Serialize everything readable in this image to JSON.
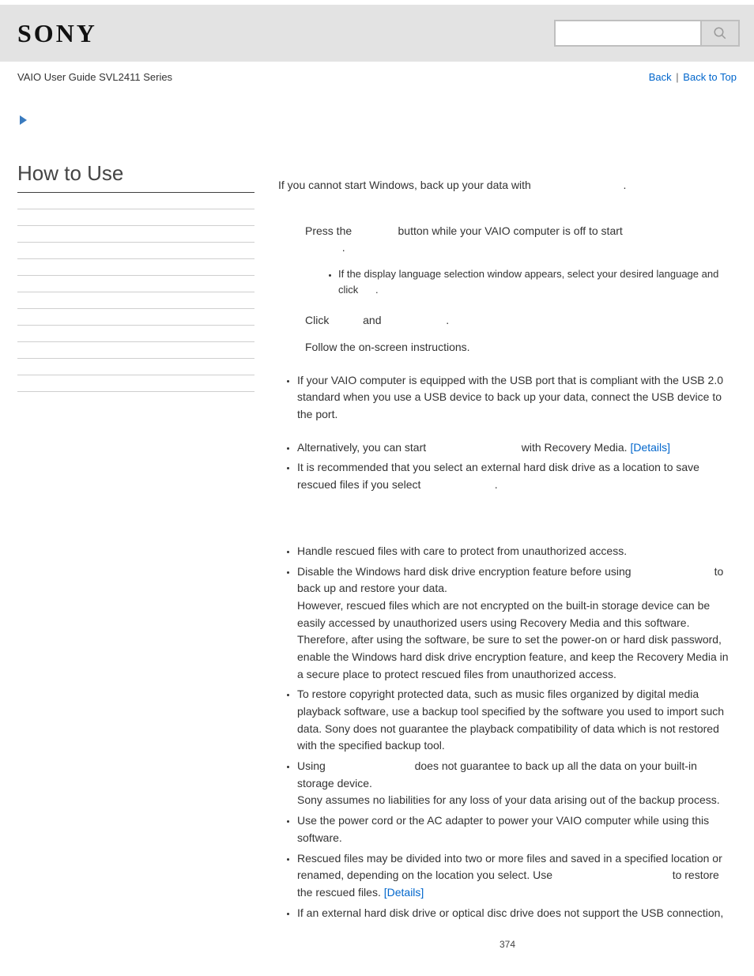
{
  "header": {
    "logo": "SONY",
    "search_placeholder": ""
  },
  "subheader": {
    "left": "VAIO User Guide SVL2411 Series",
    "back": "Back",
    "back_to_top": "Back to Top"
  },
  "sidebar": {
    "title": "How to Use"
  },
  "content": {
    "intro_1": "If you cannot start Windows, back up your data with ",
    "intro_2": ".",
    "step1_a": "Press the ",
    "step1_b": " button while your VAIO computer is off to start",
    "step1_c": ".",
    "sub1_a": "If the display language selection window appears, select your desired language and click ",
    "sub1_b": ".",
    "step2_a": "Click ",
    "step2_b": " and ",
    "step2_c": ".",
    "step3": "Follow the on-screen instructions.",
    "usb_note": "If your VAIO computer is equipped with the USB port that is compliant with the USB 2.0 standard when you use a USB device to back up your data, connect the USB device to the port.",
    "alt1_a": "Alternatively, you can start ",
    "alt1_b": " with Recovery Media. ",
    "details": "[Details]",
    "alt2_a": "It is recommended that you select an external hard disk drive as a location to save rescued files if you select ",
    "alt2_b": ".",
    "note1": "Handle rescued files with care to protect from unauthorized access.",
    "note2_a": "Disable the Windows hard disk drive encryption feature before using ",
    "note2_b": " to back up and restore your data.",
    "note2_c": "However, rescued files which are not encrypted on the built-in storage device can be easily accessed by unauthorized users using Recovery Media and this software. Therefore, after using the software, be sure to set the power-on or hard disk password, enable the Windows hard disk drive encryption feature, and keep the Recovery Media in a secure place to protect rescued files from unauthorized access.",
    "note3": "To restore copyright protected data, such as music files organized by digital media playback software, use a backup tool specified by the software you used to import such data. Sony does not guarantee the playback compatibility of data which is not restored with the specified backup tool.",
    "note4_a": "Using ",
    "note4_b": " does not guarantee to back up all the data on your built-in storage device.",
    "note4_c": "Sony assumes no liabilities for any loss of your data arising out of the backup process.",
    "note5": "Use the power cord or the AC adapter to power your VAIO computer while using this software.",
    "note6_a": "Rescued files may be divided into two or more files and saved in a specified location or renamed, depending on the location you select. Use ",
    "note6_b": " to restore the rescued files. ",
    "note7": "If an external hard disk drive or optical disc drive does not support the USB connection,"
  },
  "page_number": "374"
}
